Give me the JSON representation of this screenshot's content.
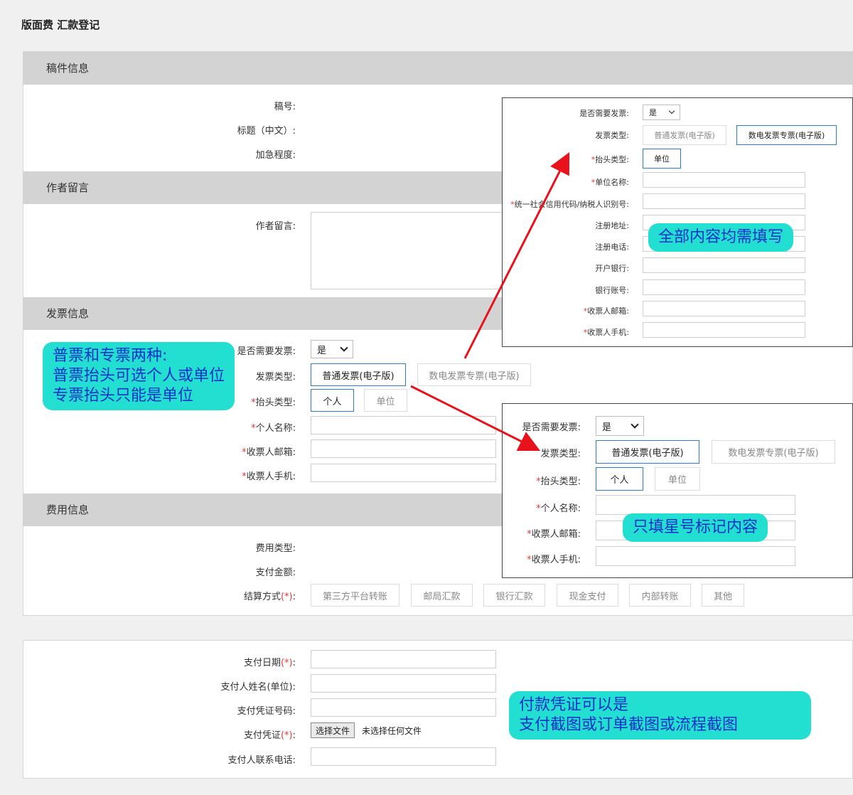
{
  "page_title": "版面费 汇款登记",
  "sections": {
    "manuscript": "稿件信息",
    "author_msg": "作者留言",
    "invoice": "发票信息",
    "fee": "费用信息"
  },
  "manuscript": {
    "id_label": "稿号:",
    "title_label": "标题（中文）:",
    "urgency_label": "加急程度:"
  },
  "author_msg": {
    "label": "作者留言:"
  },
  "invoice": {
    "need_label": "是否需要发票:",
    "need_value": "是",
    "type_label": "发票类型:",
    "type_normal": "普通发票(电子版)",
    "type_special": "数电发票专票(电子版)",
    "title_type_label": "抬头类型:",
    "title_personal": "个人",
    "title_company": "单位",
    "personal_name_label": "个人名称:",
    "email_label": "收票人邮箱:",
    "phone_label": "收票人手机:"
  },
  "fee": {
    "type_label": "费用类型:",
    "amount_label": "支付金额:",
    "settle_label": "结算方式",
    "required_mark": "(*)",
    "settle_colon": ":",
    "methods": [
      "第三方平台转账",
      "邮局汇款",
      "银行汇款",
      "现金支付",
      "内部转账",
      "其他"
    ]
  },
  "payment": {
    "date_label": "支付日期",
    "payer_label": "支付人姓名(单位):",
    "voucher_no_label": "支付凭证号码:",
    "voucher_label": "支付凭证",
    "file_button": "选择文件",
    "file_status": "未选择任何文件",
    "phone_label": "支付人联系电话:"
  },
  "popup_special": {
    "need_label": "是否需要发票:",
    "need_value": "是",
    "type_label": "发票类型:",
    "type_normal": "普通发票(电子版)",
    "type_special": "数电发票专票(电子版)",
    "title_type_label": "抬头类型:",
    "title_company": "单位",
    "company_name_label": "单位名称:",
    "tax_id_label": "统一社会信用代码/纳税人识别号:",
    "address_label": "注册地址:",
    "reg_phone_label": "注册电话:",
    "bank_label": "开户银行:",
    "account_label": "银行账号:",
    "email_label": "收票人邮箱:",
    "phone_label": "收票人手机:"
  },
  "popup_normal": {
    "need_label": "是否需要发票:",
    "need_value": "是",
    "type_label": "发票类型:",
    "type_normal": "普通发票(电子版)",
    "type_special": "数电发票专票(电子版)",
    "title_type_label": "抬头类型:",
    "title_personal": "个人",
    "title_company": "单位",
    "personal_name_label": "个人名称:",
    "email_label": "收票人邮箱:",
    "phone_label": "收票人手机:"
  },
  "callouts": {
    "invoice_types": [
      "普票和专票两种:",
      "普票抬头可选个人或单位",
      "专票抬头只能是单位"
    ],
    "fill_all": "全部内容均需填写",
    "fill_starred": "只填星号标记内容",
    "voucher_hint": [
      "付款凭证可以是",
      "支付截图或订单截图或流程截图"
    ]
  },
  "required_star": "*",
  "colors": {
    "accent": "#2a7cc7",
    "required": "#e53935",
    "callout_bg": "#22dfd1",
    "callout_text": "#1432c8",
    "arrow": "#e8121c"
  }
}
